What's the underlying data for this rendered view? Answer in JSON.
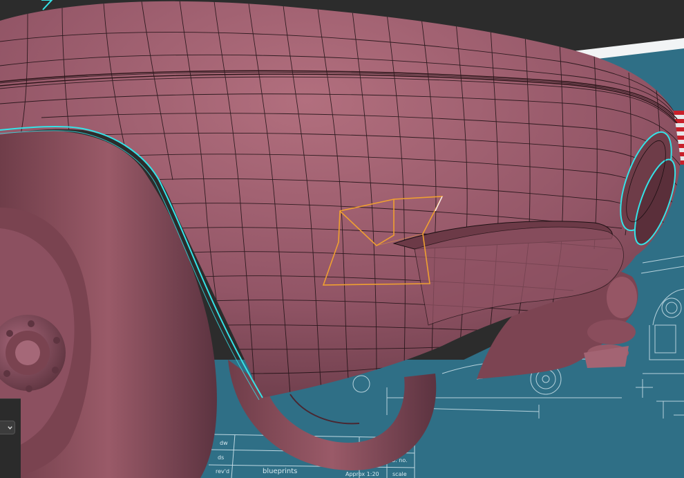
{
  "viewport": {
    "name": "3d-viewport",
    "background_color": "#2c2c2c",
    "model_color": "#9a5a68",
    "wire_color": "#1b0f12",
    "seam_color": "#34e4e8",
    "selection_color": "#f0a030",
    "blueprint_color": "#2f6f86"
  },
  "blueprint": {
    "labels": [
      "dw",
      "ds",
      "rev'd",
      "job. no.",
      "scale",
      "Approx 1:20",
      "blueprints"
    ]
  },
  "panel": {
    "dropdown_icon": "chevron-down-icon"
  }
}
